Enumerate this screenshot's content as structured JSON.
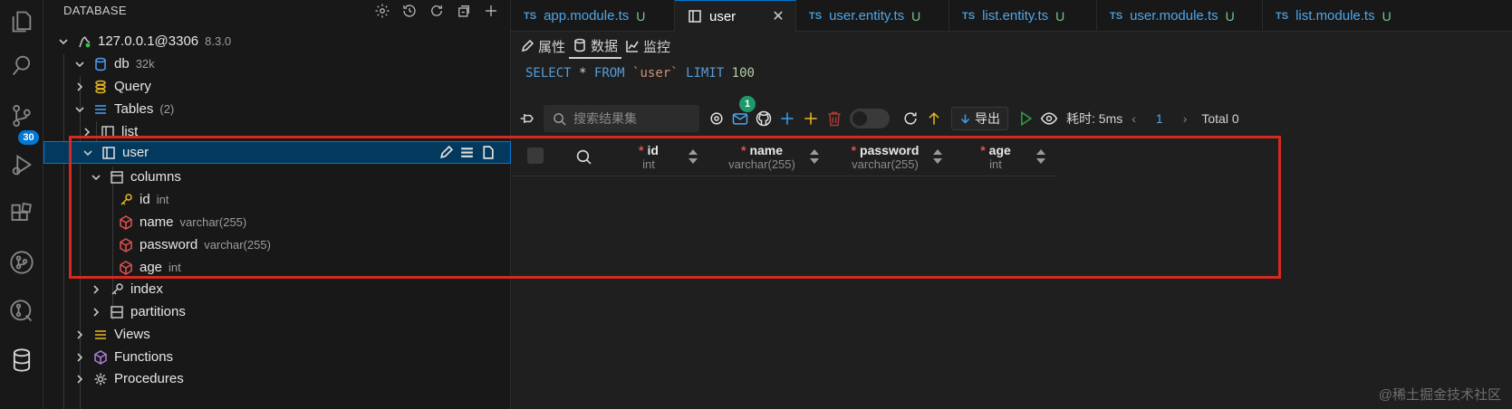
{
  "sidebar": {
    "title": "DATABASE",
    "tree": {
      "connection": {
        "label": "127.0.0.1@3306",
        "desc": "8.3.0"
      },
      "database": {
        "label": "db",
        "desc": "32k"
      },
      "query": {
        "label": "Query"
      },
      "tables": {
        "label": "Tables",
        "desc": "(2)"
      },
      "table_list": {
        "label": "list"
      },
      "table_user": {
        "label": "user"
      },
      "columns": {
        "label": "columns"
      },
      "col_id": {
        "label": "id",
        "desc": "int"
      },
      "col_name": {
        "label": "name",
        "desc": "varchar(255)"
      },
      "col_password": {
        "label": "password",
        "desc": "varchar(255)"
      },
      "col_age": {
        "label": "age",
        "desc": "int"
      },
      "index": {
        "label": "index"
      },
      "partitions": {
        "label": "partitions"
      },
      "views": {
        "label": "Views"
      },
      "functions": {
        "label": "Functions"
      },
      "procedures": {
        "label": "Procedures"
      }
    }
  },
  "activity_bar": {
    "scm_badge": "30"
  },
  "tabs": [
    {
      "lang": "TS",
      "name": "app.module.ts",
      "mark": "U"
    },
    {
      "lang": "",
      "name": "user",
      "mark": ""
    },
    {
      "lang": "TS",
      "name": "user.entity.ts",
      "mark": "U"
    },
    {
      "lang": "TS",
      "name": "list.entity.ts",
      "mark": "U"
    },
    {
      "lang": "TS",
      "name": "user.module.ts",
      "mark": "U"
    },
    {
      "lang": "TS",
      "name": "list.module.ts",
      "mark": "U"
    }
  ],
  "editor": {
    "subtabs": {
      "properties": "属性",
      "data": "数据",
      "monitor": "监控"
    },
    "sql": {
      "select": "SELECT",
      "star": "*",
      "from": "FROM",
      "table": "`user`",
      "limit": "LIMIT",
      "limit_value": "100"
    },
    "toolbar": {
      "search_placeholder": "搜索结果集",
      "notification_count": "1",
      "export_label": "导出",
      "elapsed": "耗时: 5ms",
      "page": "1",
      "total": "Total 0"
    },
    "grid": {
      "columns": [
        {
          "name": "id",
          "type": "int"
        },
        {
          "name": "name",
          "type": "varchar(255)"
        },
        {
          "name": "password",
          "type": "varchar(255)"
        },
        {
          "name": "age",
          "type": "int"
        }
      ]
    }
  },
  "watermark": "@稀土掘金技术社区",
  "colors": {
    "accent": "#0078d4",
    "selection": "#04395e",
    "annotation": "#d42a20",
    "required": "#e05252"
  }
}
